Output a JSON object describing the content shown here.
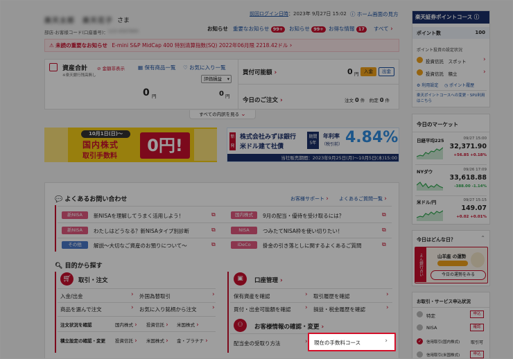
{
  "header": {
    "user_name": "楽天太郎　楽天花子",
    "user_suffix": "さま",
    "branch_label": "部店-お客様コード(口座番号)：",
    "branch_value": "123-4567890",
    "last_login_label": "前回ログイン日時",
    "last_login_value": "：2023年 9月27日 15:02",
    "home_view": "ホーム画面の見方"
  },
  "notice_tabs": {
    "title": "お知らせ",
    "important": "重要なお知らせ",
    "important_count": "99+",
    "info": "お知らせ",
    "info_count": "99+",
    "deals": "お得な情報",
    "deals_count": "17",
    "all": "すべて"
  },
  "alert": {
    "text": "未読の重要なお知らせ",
    "detail": "E-mini S&P MidCap 400 特別清算指数(SQ) 2022年06月限 2218.42ドル"
  },
  "assets": {
    "title": "資産合計",
    "hide": "金額非表示",
    "note": "※楽天銀行残高無し",
    "holdings": "保有商品一覧",
    "favorites": "お気に入り一覧",
    "value": "0",
    "unit": "円",
    "pl_select": "評価損益",
    "pl_value": "0",
    "pl_unit": "円"
  },
  "buying": {
    "title": "買付可能額",
    "value": "0",
    "unit": "円",
    "deposit": "入金",
    "withdraw": "出金"
  },
  "orders": {
    "title": "今日のご注文",
    "filled_label": "注文",
    "filled_count": "0",
    "filled_unit": "件",
    "exec_label": "約定",
    "exec_count": "0",
    "exec_unit": "件"
  },
  "see_all": "すべての内訳を見る",
  "banner1": {
    "date": "10月1日(日)〜",
    "line1": "国内株式",
    "line2": "取引手数料",
    "value": "0円!"
  },
  "banner2": {
    "new_tag": "新発",
    "line1": "株式会社みずほ銀行",
    "line2": "米ドル建て社債",
    "term1": "期間",
    "term2": "5年",
    "rate_label": "年利率",
    "rate_sub": "（税引前）",
    "rate_value": "4.84%",
    "period": "当社販売期間：2023年9月25日(月)〜10月5日(木)15:00"
  },
  "faq": {
    "title": "よくあるお問い合わせ",
    "support": "お客様サポート",
    "faq_list": "よくあるご質問一覧",
    "rows": [
      {
        "tag": "新NISA",
        "q": "新NISAを理解してうまく活用しよう！",
        "tag2": "国内株式",
        "q2": "9月の配当・優待を受け取るには？"
      },
      {
        "tag": "新NISA",
        "q": "わたしはどうなる？新NISAタイプ別診断",
        "tag2": "NISA",
        "q2": "つみたてNISA枠を使い切りたい！"
      },
      {
        "tag": "その他",
        "q": "解説〜大切なご資産のお預りについて〜",
        "tag2": "iDeCo",
        "q2": "掛金の引き落としに関するよくあるご質問"
      }
    ]
  },
  "purpose": {
    "title": "目的から探す",
    "trade": {
      "title": "取引・注文",
      "items": [
        "入金/出金",
        "外国為替取引",
        "商品を選んで注文",
        "お気に入り銘柄から注文"
      ],
      "status_label": "注文状況を確認",
      "status_links": [
        "国内株式",
        "投資信託",
        "米国株式"
      ],
      "margin_label": "積立設定の確認・変更",
      "margin_links": [
        "投資信託",
        "米国株式",
        "金・プラチナ"
      ]
    },
    "account": {
      "title": "口座管理",
      "items": [
        "保有資産を確認",
        "取引履歴を確認",
        "買付・出金可能額を確認",
        "損益・税金履歴を確認"
      ]
    },
    "customer": {
      "title": "お客様情報の確認・変更",
      "items": [
        "配当金の受取り方法",
        "現在の手数料コース"
      ]
    }
  },
  "points": {
    "title": "楽天証券ポイントコース",
    "count_label": "ポイント数",
    "count_value": "100",
    "settings": "ポイント投資の設定状況",
    "row1_name": "投資信託",
    "row1_value": "スポット",
    "row2_name": "投資信託",
    "row2_value": "積立",
    "use_settings": "利用設定",
    "history": "ポイント履歴",
    "note": "楽天ポイントコースへの変更・SPU利用はこちら"
  },
  "market": {
    "title": "今日のマーケット",
    "items": [
      {
        "name": "日経平均225",
        "date": "09/27 15:00",
        "value": "32,371.90",
        "change": "+56.85 +0.18%",
        "up": true
      },
      {
        "name": "NYダウ",
        "date": "09/26 17:09",
        "value": "33,618.88",
        "change": "-388.00 -1.14%",
        "up": false
      },
      {
        "name": "米ドル/円",
        "date": "09/27 15:15",
        "value": "149.07",
        "change": "+0.02 +0.01%",
        "up": true
      }
    ]
  },
  "fortune": {
    "title": "今日はどんな日？",
    "vertical": "えん銀行占い",
    "sign": "山羊座 の運勢",
    "link": "今日の運勢をみる"
  },
  "services": {
    "title": "お取引・サービス申込状況",
    "rows": [
      {
        "name": "特定",
        "status": "申込"
      },
      {
        "name": "NISA",
        "status": "確認"
      },
      {
        "name": "信用取引(国内株式)",
        "status": "取引可"
      },
      {
        "name": "信用取引(米国株式)",
        "status": "申込"
      }
    ]
  }
}
